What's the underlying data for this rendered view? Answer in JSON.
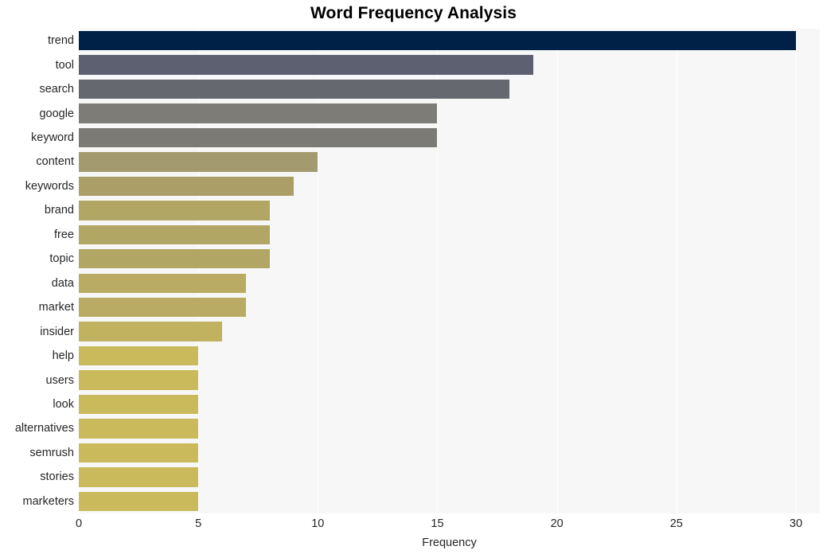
{
  "chart_data": {
    "type": "bar",
    "orientation": "horizontal",
    "title": "Word Frequency Analysis",
    "xlabel": "Frequency",
    "ylabel": "",
    "xlim": [
      0,
      31
    ],
    "ylim": [
      0,
      20
    ],
    "grid": true,
    "legend": null,
    "xticks": [
      0,
      5,
      10,
      15,
      20,
      25,
      30
    ],
    "xticklabels": [
      "0",
      "5",
      "10",
      "15",
      "20",
      "25",
      "30"
    ],
    "categories": [
      "trend",
      "tool",
      "search",
      "google",
      "keyword",
      "content",
      "keywords",
      "brand",
      "free",
      "topic",
      "data",
      "market",
      "insider",
      "help",
      "users",
      "look",
      "alternatives",
      "semrush",
      "stories",
      "marketers"
    ],
    "values": [
      30,
      19,
      18,
      15,
      15,
      10,
      9,
      8,
      8,
      8,
      7,
      7,
      6,
      5,
      5,
      5,
      5,
      5,
      5,
      5
    ],
    "bar_colors": [
      "#002147",
      "#5c6070",
      "#65686f",
      "#7d7c77",
      "#7c7a74",
      "#a39a6f",
      "#ab9f67",
      "#b2a665",
      "#b2a665",
      "#b2a665",
      "#b9ab63",
      "#b9ab63",
      "#c1b260",
      "#cbba5c",
      "#cbba5c",
      "#cbba5c",
      "#cbba5c",
      "#cbba5c",
      "#cbba5c",
      "#cbba5c"
    ],
    "plot_background": "#f7f7f7",
    "gridline_color": "#ffffff",
    "figure_background": "#ffffff"
  }
}
